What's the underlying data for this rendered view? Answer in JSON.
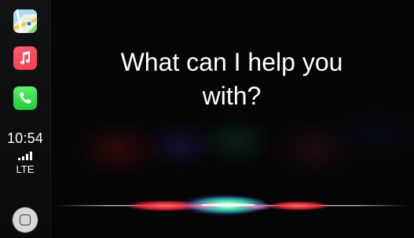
{
  "sidebar": {
    "apps": [
      {
        "name": "Maps",
        "icon": "maps-icon"
      },
      {
        "name": "Music",
        "icon": "music-note-icon"
      },
      {
        "name": "Phone",
        "icon": "phone-icon"
      }
    ],
    "status": {
      "time": "10:54",
      "network": "LTE",
      "signal_bars": 4
    },
    "home_button_icon": "home-square-icon"
  },
  "siri": {
    "prompt": "What can I help you with?",
    "waveform_icon": "siri-waveform-icon",
    "colors": {
      "red": "#ff3b45",
      "green": "#3cf0a0",
      "blue": "#3aa0ff",
      "pink": "#ff5aa8"
    }
  }
}
